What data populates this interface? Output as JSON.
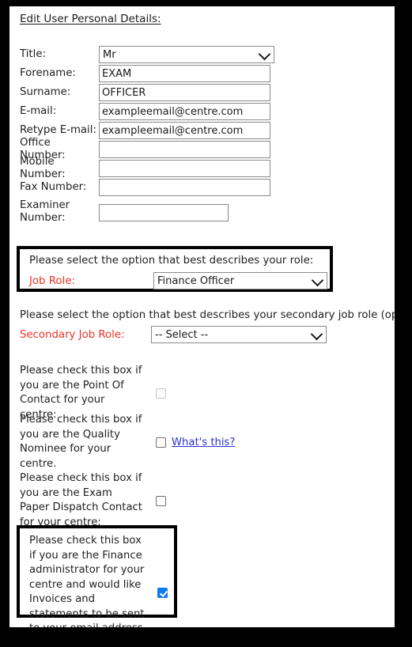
{
  "page": {
    "title": "Edit User Personal Details:"
  },
  "personal_details": {
    "fields": [
      {
        "label": "Title:",
        "type": "select",
        "value": "Mr"
      },
      {
        "label": "Forename:",
        "type": "text",
        "value": "EXAM",
        "placeholder": ""
      },
      {
        "label": "Surname:",
        "type": "text",
        "value": "OFFICER",
        "placeholder": ""
      },
      {
        "label": "E-mail:",
        "type": "text",
        "value": "exampleemail@centre.com",
        "placeholder": ""
      },
      {
        "label": "Retype E-mail:",
        "type": "text",
        "value": "exampleemail@centre.com",
        "placeholder": ""
      },
      {
        "label": "Office Number:",
        "type": "text",
        "value": "",
        "placeholder": ""
      },
      {
        "label": "Mobile Number:",
        "type": "text",
        "value": "",
        "placeholder": ""
      },
      {
        "label": "Fax Number:",
        "type": "text",
        "value": "",
        "placeholder": ""
      },
      {
        "label": "Examiner Number:",
        "type": "text",
        "value": "",
        "placeholder": ""
      }
    ]
  },
  "job_role": {
    "prompt": "Please select the option that best describes your role:",
    "label": "Job Role:",
    "value": "Finance Officer",
    "highlighted": true
  },
  "secondary_job_role": {
    "prompt": "Please select the option that best describes your secondary job role (optional):",
    "label": "Secondary Job Role:",
    "value": "-- Select --"
  },
  "checkboxes": [
    {
      "text": "Please check this box if you are the Point Of Contact for your centre:",
      "checked": false,
      "disabled": true,
      "link": ""
    },
    {
      "text": "Please check this box if you are the Quality Nominee for your centre.",
      "checked": false,
      "disabled": false,
      "link": "What's this?"
    },
    {
      "text": "Please check this box if you are the Exam Paper Dispatch Contact for your centre:",
      "checked": false,
      "disabled": false,
      "link": ""
    }
  ],
  "finance_checkbox": {
    "text": "Please check this box if you are the Finance administrator for your centre and would like Invoices and statements to be sent to your email address provided above:",
    "checked": true,
    "highlighted": true
  },
  "colors": {
    "required_label": "#ee3124",
    "link": "#2b32d4",
    "checkbox_checked": "#0b7bf1",
    "highlight_border": "#000000",
    "page_background": "#ffffff",
    "frame": "#000000"
  },
  "icons": {
    "select_chevron": "chevron-down-icon",
    "check_mark": "check-icon"
  }
}
